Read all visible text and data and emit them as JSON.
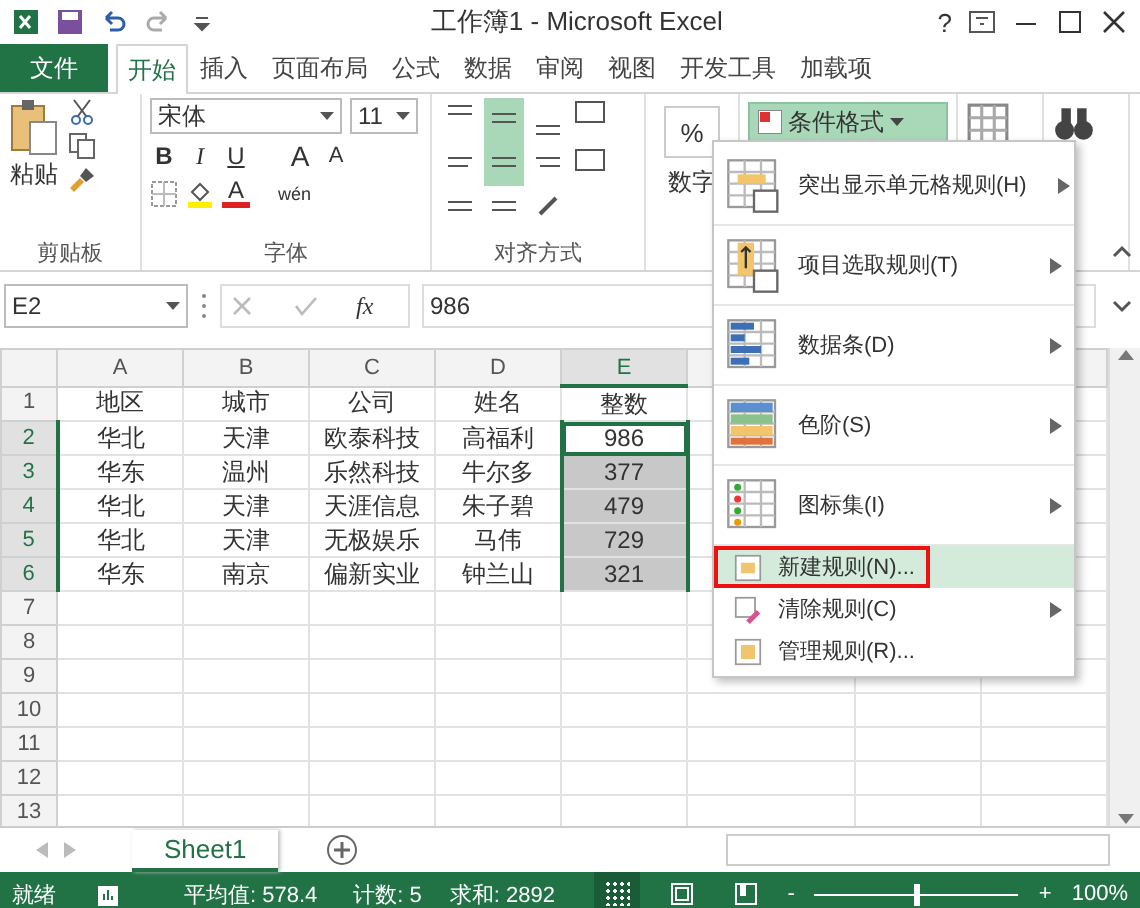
{
  "window": {
    "title": "工作簿1 - Microsoft Excel",
    "help": "?"
  },
  "ribbon_tabs": [
    {
      "label": "文件",
      "kind": "file",
      "selected": false
    },
    {
      "label": "开始",
      "kind": "tab",
      "selected": true
    },
    {
      "label": "插入",
      "kind": "tab",
      "selected": false
    },
    {
      "label": "页面布局",
      "kind": "tab",
      "selected": false
    },
    {
      "label": "公式",
      "kind": "tab",
      "selected": false
    },
    {
      "label": "数据",
      "kind": "tab",
      "selected": false
    },
    {
      "label": "审阅",
      "kind": "tab",
      "selected": false
    },
    {
      "label": "视图",
      "kind": "tab",
      "selected": false
    },
    {
      "label": "开发工具",
      "kind": "tab",
      "selected": false
    },
    {
      "label": "加载项",
      "kind": "tab",
      "selected": false
    }
  ],
  "clipboard": {
    "paste": "粘贴",
    "group_label": "剪贴板"
  },
  "font": {
    "name": "宋体",
    "size": "11",
    "styles": [
      "B",
      "I",
      "U"
    ],
    "grow": "A",
    "shrink": "A",
    "font_color": "A",
    "phonetic": "wén",
    "group_label": "字体"
  },
  "alignment": {
    "group_label": "对齐方式"
  },
  "number": {
    "symbol": "%",
    "label": "数字"
  },
  "conditional_format": {
    "label": "条件格式",
    "expanded": true
  },
  "formula_bar": {
    "name_box": "E2",
    "fx": "fx",
    "value": "986"
  },
  "columns": [
    {
      "label": "A",
      "selected": false
    },
    {
      "label": "B",
      "selected": false
    },
    {
      "label": "C",
      "selected": false
    },
    {
      "label": "D",
      "selected": false
    },
    {
      "label": "E",
      "selected": true
    }
  ],
  "rows": [
    {
      "number": "1",
      "selected": false,
      "cells": [
        "地区",
        "城市",
        "公司",
        "姓名",
        "整数"
      ]
    },
    {
      "number": "2",
      "selected": true,
      "active": true,
      "cells": [
        "华北",
        "天津",
        "欧泰科技",
        "高福利",
        "986"
      ]
    },
    {
      "number": "3",
      "selected": true,
      "cells": [
        "华东",
        "温州",
        "乐然科技",
        "牛尔多",
        "377"
      ]
    },
    {
      "number": "4",
      "selected": true,
      "cells": [
        "华北",
        "天津",
        "天涯信息",
        "朱子碧",
        "479"
      ]
    },
    {
      "number": "5",
      "selected": true,
      "cells": [
        "华北",
        "天津",
        "无极娱乐",
        "马伟",
        "729"
      ]
    },
    {
      "number": "6",
      "selected": true,
      "cells": [
        "华东",
        "南京",
        "偏新实业",
        "钟兰山",
        "321"
      ]
    },
    {
      "number": "7",
      "selected": false,
      "cells": []
    },
    {
      "number": "8",
      "selected": false,
      "cells": []
    },
    {
      "number": "9",
      "selected": false,
      "cells": []
    },
    {
      "number": "10",
      "selected": false,
      "cells": []
    },
    {
      "number": "11",
      "selected": false,
      "cells": []
    },
    {
      "number": "12",
      "selected": false,
      "cells": []
    },
    {
      "number": "13",
      "selected": false,
      "cells": []
    }
  ],
  "menu": [
    {
      "label": "突出显示单元格规则(H)",
      "kind": "highlight",
      "submenu": true,
      "selected": false
    },
    {
      "label": "项目选取规则(T)",
      "kind": "top",
      "submenu": true,
      "selected": false
    },
    {
      "label": "数据条(D)",
      "kind": "databar",
      "submenu": true,
      "selected": false
    },
    {
      "label": "色阶(S)",
      "kind": "colorscale",
      "submenu": true,
      "selected": false
    },
    {
      "label": "图标集(I)",
      "kind": "iconset",
      "submenu": true,
      "selected": false
    },
    {
      "label": "新建规则(N)...",
      "kind": "new",
      "submenu": false,
      "selected": true,
      "annotated": true
    },
    {
      "label": "清除规则(C)",
      "kind": "clear",
      "submenu": true,
      "selected": false
    },
    {
      "label": "管理规则(R)...",
      "kind": "manage",
      "submenu": false,
      "selected": false
    }
  ],
  "sheet_tabs": [
    {
      "label": "Sheet1",
      "selected": true
    }
  ],
  "status_bar": {
    "ready": "就绪",
    "average": "平均值: 578.4",
    "count": "计数: 5",
    "sum": "求和: 2892",
    "zoom_out": "-",
    "zoom_in": "+",
    "zoom": {
      "level": 0.5
    },
    "zoom_text": "100%"
  }
}
